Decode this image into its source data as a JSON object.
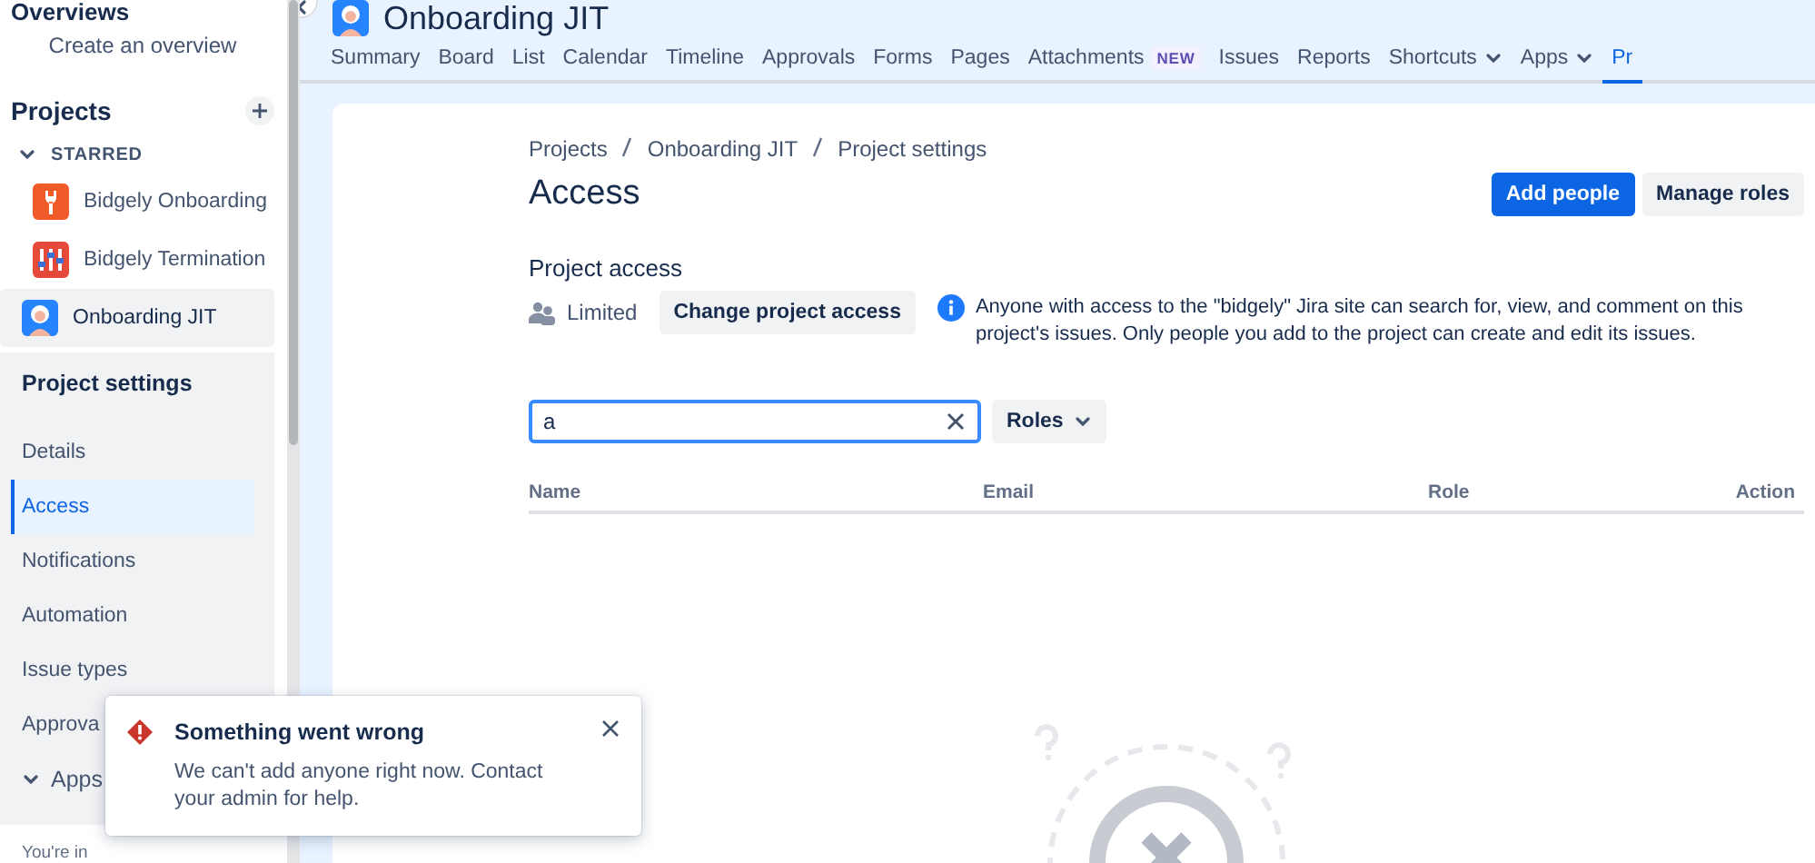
{
  "sidebar": {
    "overviews_heading": "Overviews",
    "create_overview": "Create an overview",
    "projects_heading": "Projects",
    "starred_label": "STARRED",
    "starred_expanded": true,
    "projects": [
      {
        "name": "Bidgely Onboarding",
        "kind": "wrench",
        "selected": false
      },
      {
        "name": "Bidgely Termination",
        "kind": "sliders",
        "selected": false
      },
      {
        "name": "Onboarding JIT",
        "kind": "person",
        "selected": true
      }
    ],
    "settings_heading": "Project settings",
    "settings_items": [
      {
        "label": "Details",
        "selected": false
      },
      {
        "label": "Access",
        "selected": true
      },
      {
        "label": "Notifications",
        "selected": false
      },
      {
        "label": "Automation",
        "selected": false
      },
      {
        "label": "Issue types",
        "selected": false
      },
      {
        "label": "Approva",
        "selected": false
      }
    ],
    "apps_label": "Apps",
    "apps_expanded": true,
    "footer": "You're in"
  },
  "header": {
    "project_title": "Onboarding JIT",
    "tabs": [
      {
        "label": "Summary",
        "selected": false,
        "dropdown": false
      },
      {
        "label": "Board",
        "selected": false,
        "dropdown": false
      },
      {
        "label": "List",
        "selected": false,
        "dropdown": false
      },
      {
        "label": "Calendar",
        "selected": false,
        "dropdown": false
      },
      {
        "label": "Timeline",
        "selected": false,
        "dropdown": false
      },
      {
        "label": "Approvals",
        "selected": false,
        "dropdown": false
      },
      {
        "label": "Forms",
        "selected": false,
        "dropdown": false
      },
      {
        "label": "Pages",
        "selected": false,
        "dropdown": false
      },
      {
        "label": "Attachments",
        "badge": "NEW",
        "selected": false,
        "dropdown": false
      },
      {
        "label": "Issues",
        "selected": false,
        "dropdown": false
      },
      {
        "label": "Reports",
        "selected": false,
        "dropdown": false
      },
      {
        "label": "Shortcuts",
        "selected": false,
        "dropdown": true
      },
      {
        "label": "Apps",
        "selected": false,
        "dropdown": true
      },
      {
        "label": "Pr",
        "selected": true,
        "dropdown": false
      }
    ]
  },
  "page": {
    "breadcrumbs": [
      "Projects",
      "Onboarding JIT",
      "Project settings"
    ],
    "title": "Access",
    "actions": [
      {
        "label": "Add people",
        "kind": "primary"
      },
      {
        "label": "Manage roles",
        "kind": "default"
      }
    ],
    "project_access": {
      "heading": "Project access",
      "level_label": "Limited",
      "change_button": "Change project access",
      "info": "Anyone with access to the \"bidgely\" Jira site can search for, view, and comment on this project's issues. Only people you add to the project can create and edit its issues."
    },
    "search": {
      "value": "a"
    },
    "roles_filter": "Roles",
    "table": {
      "columns": [
        "Name",
        "Email",
        "Role",
        "Action"
      ]
    }
  },
  "toast": {
    "title": "Something went wrong",
    "message": "We can't add anyone right now. Contact your admin for help."
  }
}
